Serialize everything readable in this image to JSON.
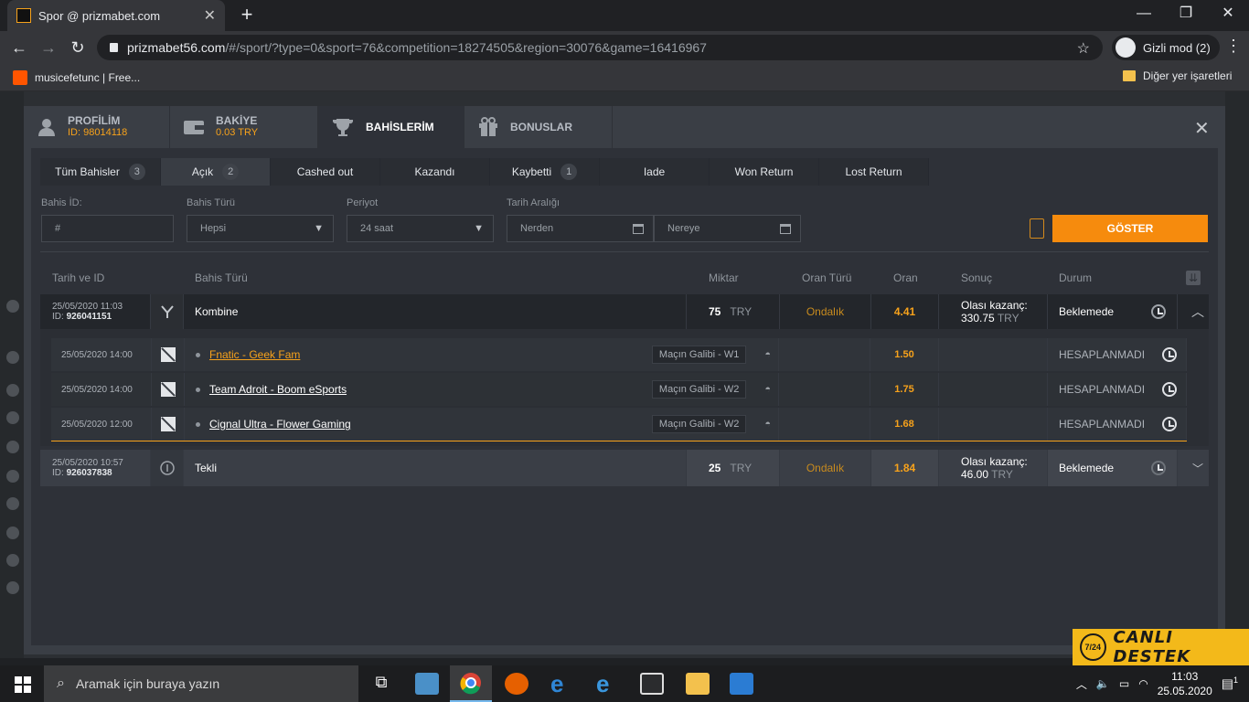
{
  "browser": {
    "tab_title": "Spor @ prizmabet.com",
    "url_host": "prizmabet56.com",
    "url_path": "/#/sport/?type=0&sport=76&competition=18274505&region=30076&game=16416967",
    "incognito_label": "Gizli mod (2)",
    "bookmark": "musicefetunc | Free...",
    "other_bookmarks": "Diğer yer işaretleri"
  },
  "modal": {
    "tabs": [
      {
        "title": "PROFİLİM",
        "sub": "ID: 98014118",
        "icon": "user-icon"
      },
      {
        "title": "BAKİYE",
        "sub": "0.03 TRY",
        "icon": "wallet-icon"
      },
      {
        "title": "BAHİSLERİM",
        "sub": "",
        "icon": "trophy-icon"
      },
      {
        "title": "BONUSLAR",
        "sub": "",
        "icon": "gift-icon"
      }
    ],
    "filter_tabs": [
      {
        "label": "Tüm Bahisler",
        "count": "3"
      },
      {
        "label": "Açık",
        "count": "2"
      },
      {
        "label": "Cashed out",
        "count": ""
      },
      {
        "label": "Kazandı",
        "count": ""
      },
      {
        "label": "Kaybetti",
        "count": "1"
      },
      {
        "label": "Iade",
        "count": ""
      },
      {
        "label": "Won Return",
        "count": ""
      },
      {
        "label": "Lost Return",
        "count": ""
      }
    ],
    "filters": {
      "bet_id_label": "Bahis İD:",
      "bet_id_placeholder": "#",
      "bet_type_label": "Bahis Türü",
      "bet_type_value": "Hepsi",
      "period_label": "Periyot",
      "period_value": "24 saat",
      "date_range_label": "Tarih Aralığı",
      "from_placeholder": "Nerden",
      "to_placeholder": "Nereye",
      "show_button": "GÖSTER"
    },
    "table": {
      "headers": [
        "Tarih ve ID",
        "Bahis Türü",
        "Miktar",
        "Oran Türü",
        "Oran",
        "Sonuç",
        "Durum"
      ],
      "bets": [
        {
          "date": "25/05/2020 11:03",
          "id_label": "ID:",
          "id": "926041151",
          "type": "Kombine",
          "amount": "75",
          "currency": "TRY",
          "odds_type": "Ondalık",
          "odds": "4.41",
          "result_label": "Olası kazanç:",
          "result_value": "330.75",
          "result_currency": "TRY",
          "status": "Beklemede",
          "selections": [
            {
              "date": "25/05/2020 14:00",
              "match": "Fnatic - Geek Fam",
              "market": "Maçın Galibi - W1",
              "odds": "1.50",
              "status": "HESAPLANMADI"
            },
            {
              "date": "25/05/2020 14:00",
              "match": "Team Adroit - Boom eSports",
              "market": "Maçın Galibi - W2",
              "odds": "1.75",
              "status": "HESAPLANMADI"
            },
            {
              "date": "25/05/2020 12:00",
              "match": "Cignal Ultra - Flower Gaming",
              "market": "Maçın Galibi - W2",
              "odds": "1.68",
              "status": "HESAPLANMADI"
            }
          ]
        },
        {
          "date": "25/05/2020 10:57",
          "id_label": "ID:",
          "id": "926037838",
          "type": "Tekli",
          "amount": "25",
          "currency": "TRY",
          "odds_type": "Ondalık",
          "odds": "1.84",
          "result_label": "Olası kazanç:",
          "result_value": "46.00",
          "result_currency": "TRY",
          "status": "Beklemede"
        }
      ]
    }
  },
  "support_banner": {
    "badge": "7/24",
    "text": "CANLI DESTEK"
  },
  "taskbar": {
    "search_placeholder": "Aramak için buraya yazın",
    "time": "11:03",
    "date": "25.05.2020",
    "notification_count": "1"
  },
  "colors": {
    "accent": "#f68b0d",
    "odds": "#f7a21b",
    "background": "#2e3138"
  }
}
